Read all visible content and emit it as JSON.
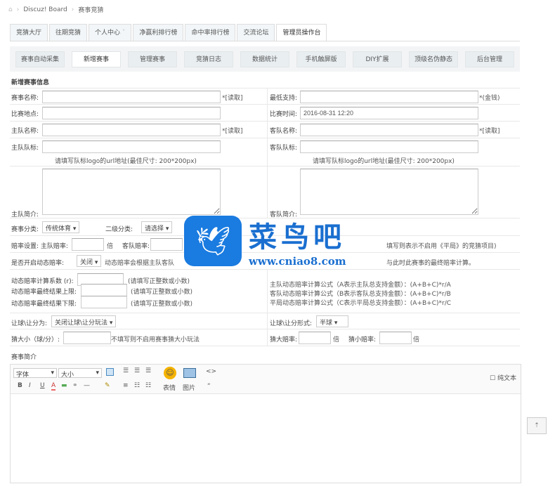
{
  "breadcrumb": {
    "items": [
      "Discuz! Board",
      "赛事竞猜"
    ]
  },
  "tabs": [
    "竞猜大厅",
    "往期竞猜",
    "个人中心",
    "净赢利排行榜",
    "命中率排行榜",
    "交流论坛",
    "管理员操作台"
  ],
  "subnav": [
    "赛事自动采集",
    "新增赛事",
    "管理赛事",
    "竞猜日志",
    "数据统计",
    "手机触屏版",
    "DIY扩展",
    "顶级名伪静态",
    "后台管理"
  ],
  "form": {
    "section_title": "新增赛事信息",
    "match_name": "赛事名称:",
    "match_name_note": "*[读取]",
    "min_support": "最低支持:",
    "min_support_note": "*(金钱)",
    "venue": "比赛地点:",
    "match_time": "比赛时间:",
    "match_time_value": "2016-08-31 12:20",
    "home_name": "主队名称:",
    "home_name_note": "*[读取]",
    "away_name": "客队名称:",
    "away_name_note": "*[读取]",
    "home_logo": "主队队标:",
    "away_logo": "客队队标:",
    "logo_hint": "请填写队标logo的url地址(最佳尺寸: 200*200px)",
    "home_intro": "主队简介:",
    "away_intro": "客队简介:",
    "category": "赛事分类:",
    "category_value": "传统体育",
    "subcategory": "二级分类:",
    "subcategory_value": "请选择",
    "odds": "赔率设置: 主队赔率:",
    "odds_unit": "倍",
    "away_odds": "客队赔率:",
    "draw_hint": "填写则表示不启用《平局》的竞猜项目)",
    "dynamic": "是否开启动态赔率:",
    "dynamic_value": "关闭",
    "dynamic_hint": "动态赔率会根据主队客队",
    "dynamic_hint2": "与此时此赛事的最终赔率计算。",
    "coef": "动态赔率计算系数 (r):",
    "coef_hint": "(请填写正整数或小数)",
    "upper": "动态赔率最终结果上限:",
    "upper_hint": "(请填写正整数或小数)",
    "lower": "动态赔率最终结果下限:",
    "lower_hint": "(请填写正整数或小数)",
    "formula_home": "主队动态赔率计算公式（A表示主队总支持金额）：(A+B+C)*r/A",
    "formula_away": "客队动态赔率计算公式（B表示客队总支持金额）：(A+B+C)*r/B",
    "formula_draw": "平局动态赔率计算公式（C表示平局总支持金额）：(A+B+C)*r/C",
    "handicap": "让球\\让分为:",
    "handicap_value": "关闭让球\\让分玩法",
    "handicap_form": "让球\\让分形式:",
    "handicap_form_value": "半球",
    "bigsmall": "猜大小（球/分）:",
    "bigsmall_hint": "不填写则不启用赛事猜大小玩法",
    "big_odds": "猜大赔率:",
    "small_odds": "猜小赔率:",
    "unit": "倍",
    "intro": "赛事简介"
  },
  "editor": {
    "font": "字体",
    "size": "大小",
    "emoji": "表情",
    "image": "图片",
    "plaintext": "纯文本",
    "bold": "B",
    "italic": "I",
    "underline": "U",
    "code": "<>",
    "quote": "“"
  },
  "watermark": {
    "title": "菜鸟吧",
    "url": "www.cniao8.com"
  }
}
